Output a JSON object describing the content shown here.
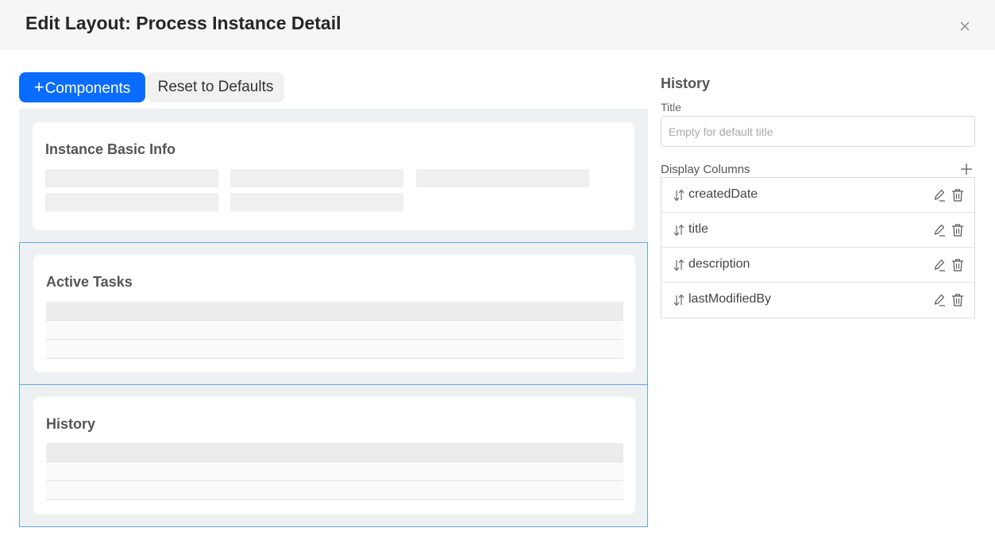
{
  "dialog": {
    "title": "Edit Layout: Process Instance Detail",
    "close_icon": "close-icon"
  },
  "toolbar": {
    "components_plus": "+",
    "components_label": "Components",
    "reset_label": "Reset to Defaults"
  },
  "canvas": {
    "basic_info_title": "Instance Basic Info",
    "active_tasks_title": "Active Tasks",
    "history_title": "History"
  },
  "side_panel": {
    "section_title": "History",
    "title_label": "Title",
    "title_value": "",
    "title_placeholder": "Empty for default title",
    "display_columns_label": "Display Columns",
    "columns": [
      {
        "name": "createdDate"
      },
      {
        "name": "title"
      },
      {
        "name": "description"
      },
      {
        "name": "lastModifiedBy"
      }
    ]
  },
  "colors": {
    "primary": "#0a6cff",
    "selection_border": "#61a8ea",
    "canvas_bg": "#eef1f4"
  }
}
